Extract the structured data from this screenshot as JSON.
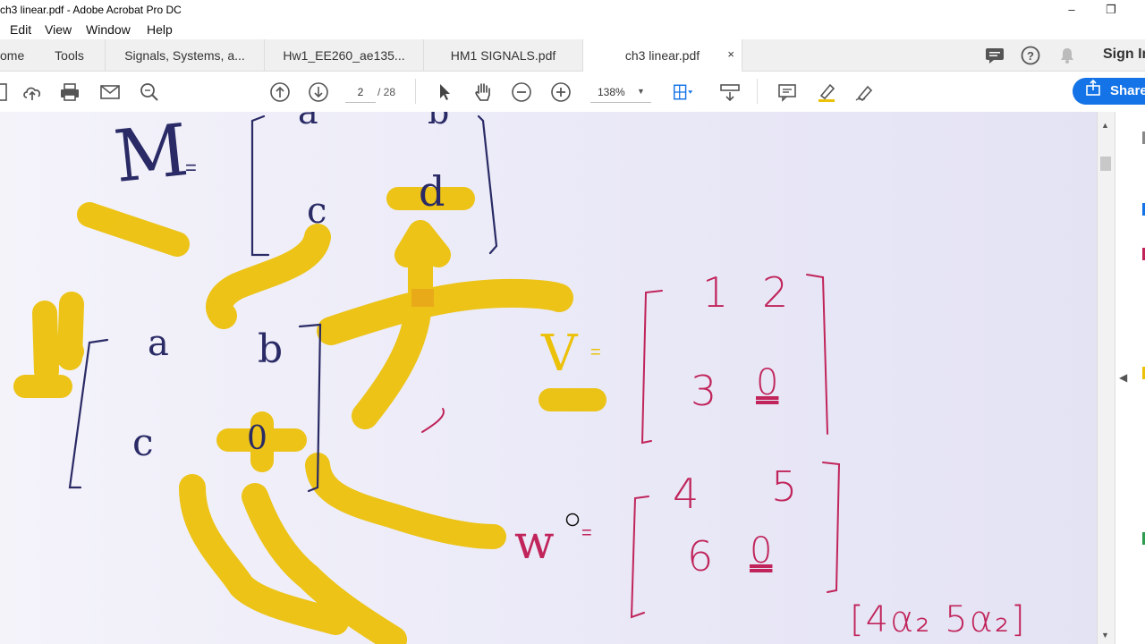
{
  "window": {
    "title": "ch3 linear.pdf - Adobe Acrobat Pro DC",
    "minimize": "–",
    "restore": "❐"
  },
  "menu": {
    "items": [
      "Edit",
      "View",
      "Window",
      "Help"
    ]
  },
  "tabs": {
    "home": "ome",
    "tools": "Tools",
    "docs": [
      "Signals, Systems, a...",
      "Hw1_EE260_ae135...",
      "HM1 SIGNALS.pdf",
      "ch3 linear.pdf"
    ],
    "close": "×",
    "sign_in": "Sign In"
  },
  "toolbar": {
    "page_current": "2",
    "page_total": "/ 28",
    "zoom": "138%",
    "share": "Share"
  },
  "colors": {
    "highlight": "#ecc10a",
    "pen_dark": "#2a2a66",
    "pen_pink": "#c0245a",
    "accent": "#1473e6"
  },
  "notes": {
    "m_var": "M",
    "m_eq": "=",
    "m_a": "a",
    "m_b": "b",
    "m_c": "c",
    "m_d": "d",
    "left_a": "a",
    "left_b": "b",
    "left_c": "c",
    "left_d": "0",
    "v_var": "V",
    "v_eq": "=",
    "v_11": "1",
    "v_12": "2",
    "v_21": "3",
    "v_22": "0",
    "w_var": "w",
    "w_eq": "=",
    "w_11": "4",
    "w_12": "5",
    "w_21": "6",
    "w_22": "0",
    "bottom_expr": "[4α₂  5α₂]"
  }
}
